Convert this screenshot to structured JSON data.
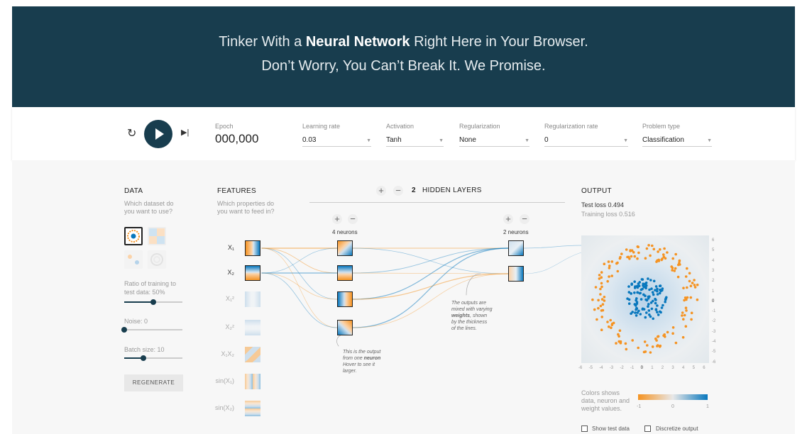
{
  "header": {
    "line1_pre": "Tinker With a ",
    "line1_bold": "Neural Network",
    "line1_post": " Right Here in Your Browser.",
    "line2": "Don’t Worry, You Can’t Break It. We Promise."
  },
  "controls": {
    "reset_icon": "↻",
    "step_icon": "▶|",
    "epoch": {
      "label": "Epoch",
      "value": "000,000"
    },
    "learning_rate": {
      "label": "Learning rate",
      "value": "0.03"
    },
    "activation": {
      "label": "Activation",
      "value": "Tanh"
    },
    "regularization": {
      "label": "Regularization",
      "value": "None"
    },
    "regularization_rate": {
      "label": "Regularization rate",
      "value": "0"
    },
    "problem_type": {
      "label": "Problem type",
      "value": "Classification"
    }
  },
  "data": {
    "title": "DATA",
    "subtitle_1": "Which dataset do",
    "subtitle_2": "you want to use?",
    "ratio_label": "Ratio of training to",
    "ratio_label_2": "test data:  50%",
    "ratio_value": 0.5,
    "noise_label": "Noise:  0",
    "noise_value": 0,
    "batch_label": "Batch size:  10",
    "batch_value": 0.33,
    "regenerate": "REGENERATE"
  },
  "features": {
    "title": "FEATURES",
    "subtitle_1": "Which properties do",
    "subtitle_2": "you want to feed in?",
    "items": [
      {
        "label": "X₁",
        "active": true
      },
      {
        "label": "X₂",
        "active": true
      },
      {
        "label": "X₁²",
        "active": false
      },
      {
        "label": "X₂²",
        "active": false
      },
      {
        "label": "X₁X₂",
        "active": false
      },
      {
        "label": "sin(X₁)",
        "active": false
      },
      {
        "label": "sin(X₂)",
        "active": false
      }
    ]
  },
  "hidden": {
    "plus": "+",
    "minus": "−",
    "count": "2",
    "label": "HIDDEN LAYERS",
    "layer1_neurons": "4 neurons",
    "layer2_neurons": "2 neurons"
  },
  "notes": {
    "neuron_note": [
      "This is the output",
      "from one",
      "neuron",
      "Hover to see it",
      "larger."
    ],
    "weights_note": [
      "The outputs are",
      "mixed with varying",
      "weights",
      ", shown",
      "by the thickness",
      "of the lines."
    ]
  },
  "output": {
    "title": "OUTPUT",
    "test_loss": "Test loss 0.494",
    "training_loss": "Training loss 0.516",
    "y_ticks": [
      "6",
      "5",
      "4",
      "3",
      "2",
      "1",
      "0",
      "-1",
      "-2",
      "-3",
      "-4",
      "-5",
      "-6"
    ],
    "x_ticks": [
      "-6",
      "-5",
      "-4",
      "-3",
      "-2",
      "-1",
      "0",
      "1",
      "2",
      "3",
      "4",
      "5",
      "6"
    ],
    "legend_text": [
      "Colors shows",
      "data, neuron and",
      "weight values."
    ],
    "legend_ticks": [
      "-1",
      "0",
      "1"
    ],
    "show_test_data": "Show test data",
    "discretize_output": "Discretize output"
  },
  "colors": {
    "header_bg": "#183d4e",
    "orange": "#f59322",
    "blue": "#0877bd"
  }
}
